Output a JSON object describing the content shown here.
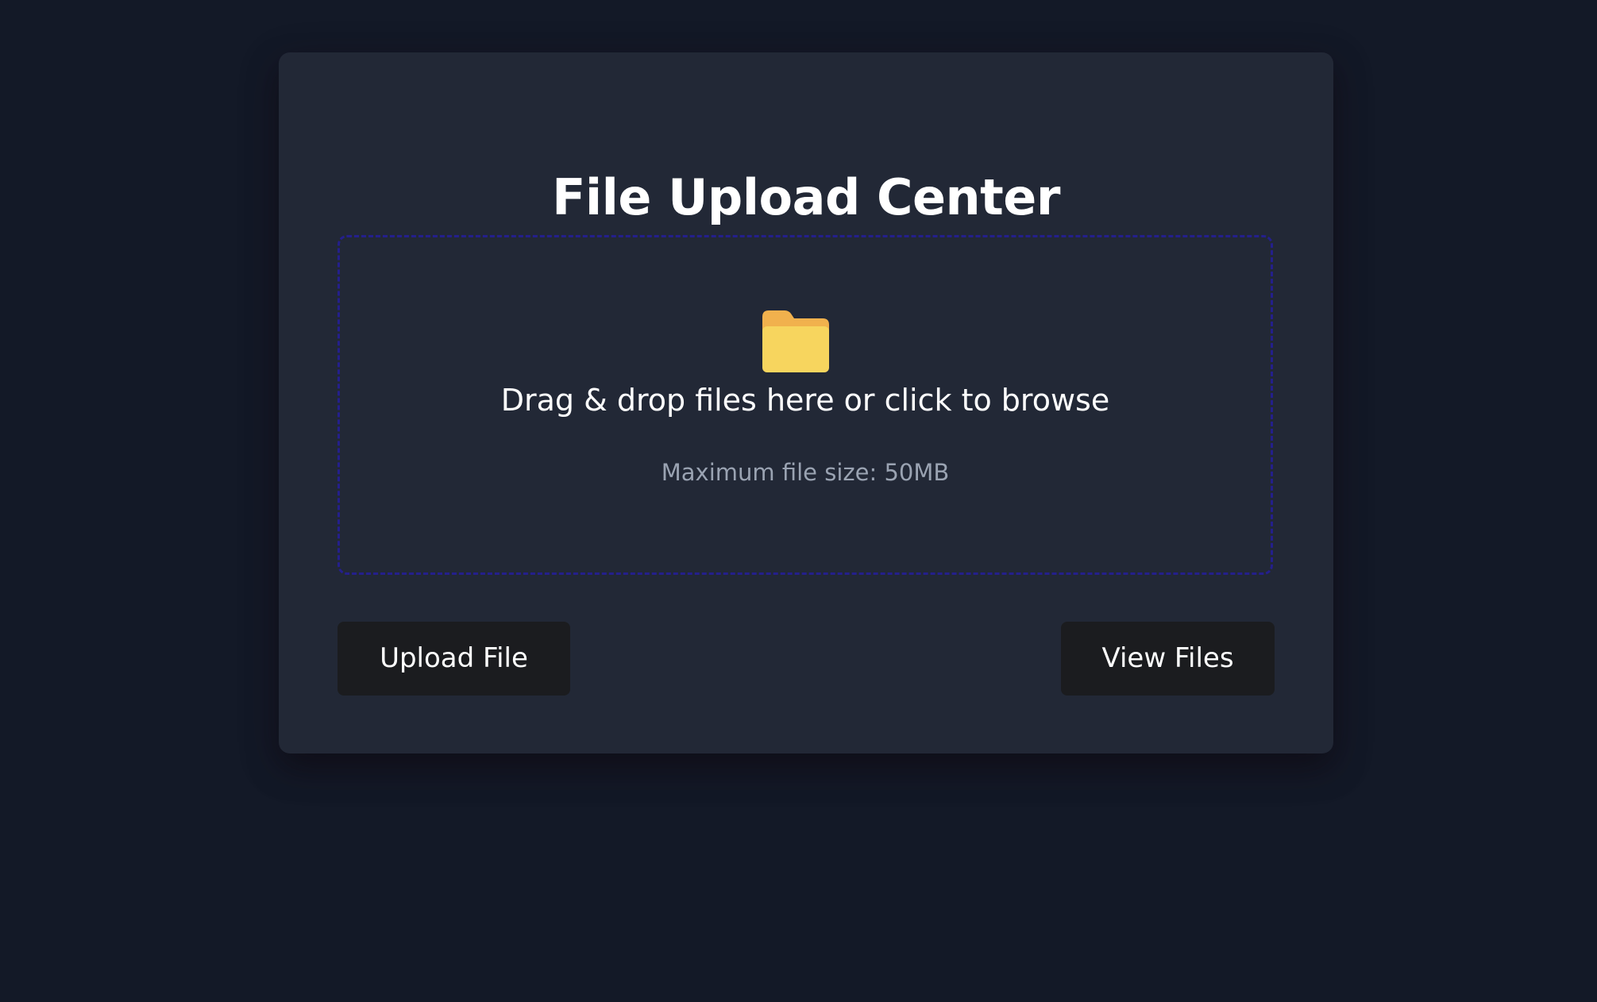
{
  "card": {
    "title": "File Upload Center"
  },
  "dropzone": {
    "icon": "folder-icon",
    "primary_text": "Drag & drop files here or click to browse",
    "hint_text": "Maximum file size: 50MB",
    "border_color": "#241f8c"
  },
  "actions": {
    "upload_label": "Upload File",
    "view_label": "View Files"
  },
  "colors": {
    "background": "#131927",
    "card": "#222836",
    "button": "#1b1c1f",
    "folder_front": "#f7d55e",
    "folder_back": "#f1b14d"
  }
}
